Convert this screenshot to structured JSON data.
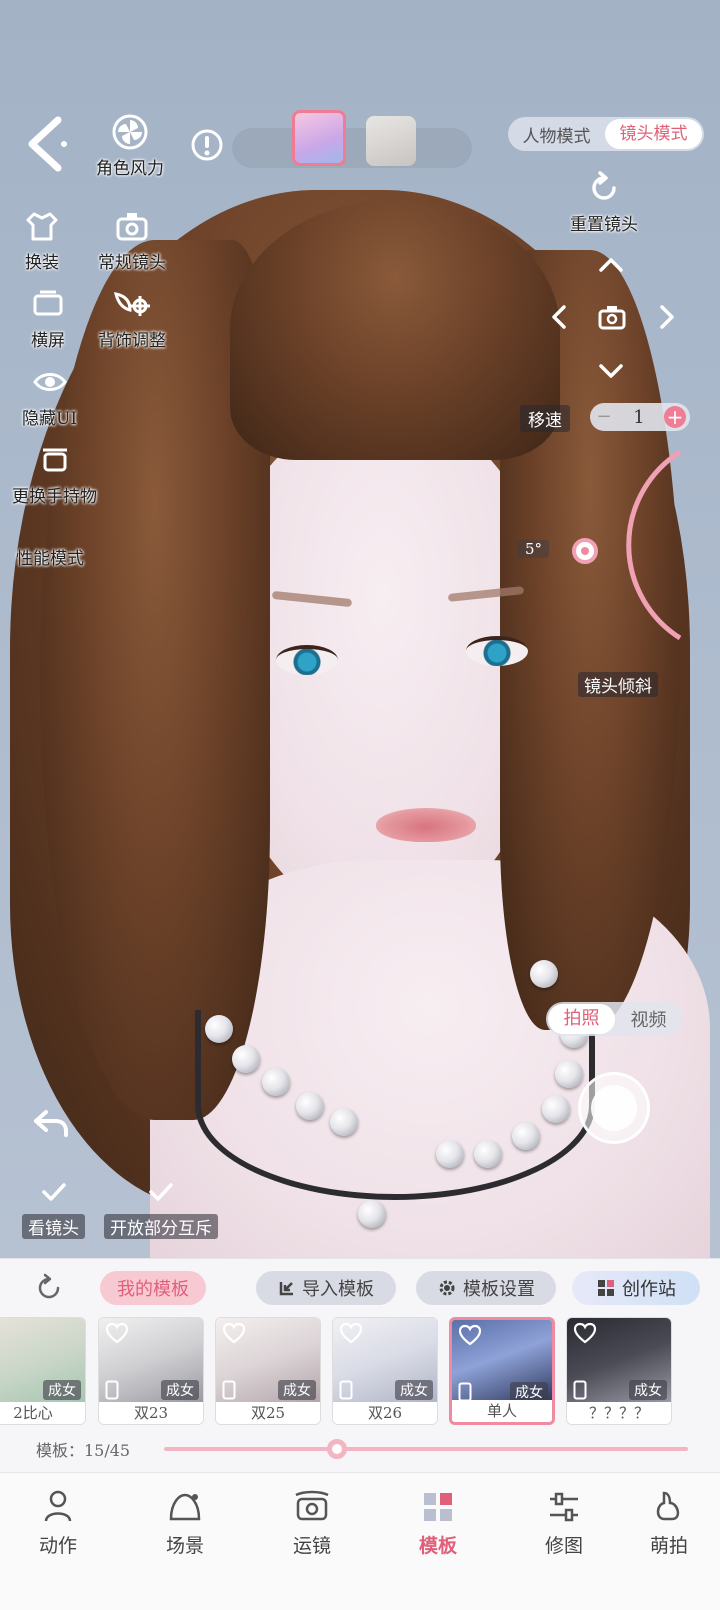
{
  "top_bar": {
    "wind_label": "角色风力",
    "mode_switch": {
      "options": [
        "人物模式",
        "镜头模式"
      ],
      "active": "镜头模式"
    }
  },
  "left_tools": {
    "change_outfit": "换装",
    "regular_camera": "常规镜头",
    "landscape": "横屏",
    "back_ornament": "背饰调整",
    "hide_ui": "隐藏UI",
    "change_held_item": "更换手持物",
    "performance_mode": "性能模式"
  },
  "camera_controls": {
    "reset_label": "重置镜头",
    "speed_label": "移速",
    "speed_value": "1",
    "tilt_value": "5°",
    "tilt_label": "镜头倾斜"
  },
  "capture": {
    "options": [
      "拍照",
      "视频"
    ],
    "active": "拍照"
  },
  "bottom_left": {
    "look_camera": "看镜头",
    "partial_interaction": "开放部分互斥"
  },
  "template_panel": {
    "my_templates": "我的模板",
    "import_template": "导入模板",
    "template_settings": "模板设置",
    "creation_station": "创作站",
    "cards": [
      {
        "name": "2比心",
        "tag": "成女",
        "selected": false
      },
      {
        "name": "双23",
        "tag": "成女",
        "selected": false
      },
      {
        "name": "双25",
        "tag": "成女",
        "selected": false
      },
      {
        "name": "双26",
        "tag": "成女",
        "selected": false
      },
      {
        "name": "单人",
        "tag": "成女",
        "selected": true
      },
      {
        "name": "？？？？",
        "tag": "成女",
        "selected": false
      }
    ],
    "progress_text": "模板：15/45",
    "progress_fraction": 0.33
  },
  "bottom_nav": {
    "items": [
      "动作",
      "场景",
      "运镜",
      "模板",
      "修图",
      "萌拍"
    ],
    "active": "模板"
  },
  "colors": {
    "accent": "#e0607a",
    "accent_light": "#f3b5c2"
  }
}
